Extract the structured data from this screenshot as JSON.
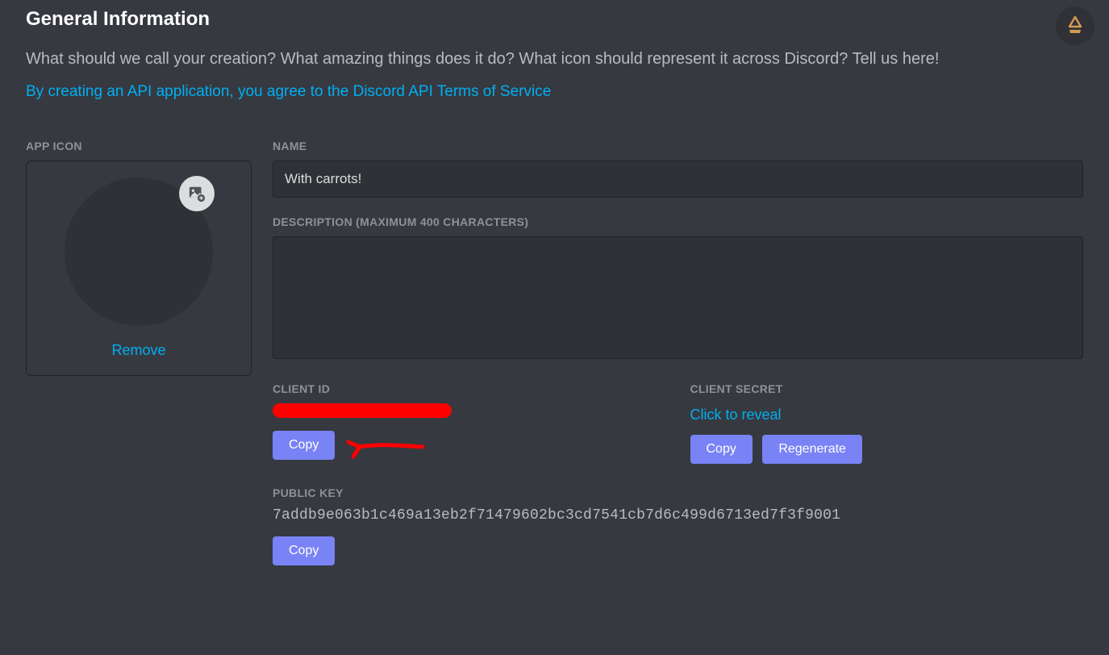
{
  "header": {
    "title": "General Information",
    "subtitle": "What should we call your creation? What amazing things does it do? What icon should represent it across Discord? Tell us here!",
    "tos_text": "By creating an API application, you agree to the Discord API Terms of Service"
  },
  "app_icon": {
    "label": "APP ICON",
    "remove_label": "Remove"
  },
  "name_field": {
    "label": "NAME",
    "value": "With carrots!"
  },
  "description_field": {
    "label": "DESCRIPTION (MAXIMUM 400 CHARACTERS)",
    "value": ""
  },
  "client_id": {
    "label": "CLIENT ID",
    "copy_label": "Copy"
  },
  "client_secret": {
    "label": "CLIENT SECRET",
    "reveal_label": "Click to reveal",
    "copy_label": "Copy",
    "regenerate_label": "Regenerate"
  },
  "public_key": {
    "label": "PUBLIC KEY",
    "value": "7addb9e063b1c469a13eb2f71479602bc3cd7541cb7d6c499d6713ed7f3f9001",
    "copy_label": "Copy"
  }
}
